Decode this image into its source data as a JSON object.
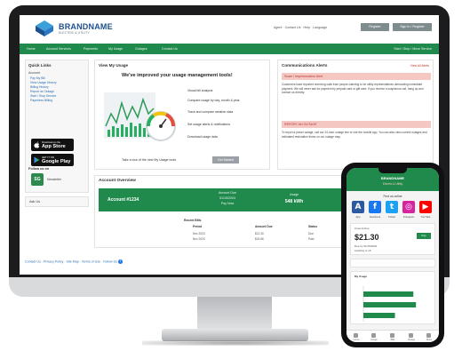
{
  "header": {
    "brand": "BRANDNAME",
    "brand_tagline": "ELECTRIC & UTILITY",
    "top_links": "Agent  ·  Contact Us  ·  Help  ·  Language",
    "register_label": "Register",
    "signin_label": "Sign In / Register"
  },
  "nav": {
    "items": [
      "Home",
      "Account Services",
      "Payments",
      "My Usage",
      "Outages",
      "Contact Us"
    ],
    "right_label": "Start / Stop / Move Service"
  },
  "sidebar": {
    "title": "Quick Links",
    "section": "Account",
    "links": [
      "Pay My Bill",
      "View Usage History",
      "Billing History",
      "Report an Outage",
      "Start / Stop Service",
      "Paperless Billing"
    ],
    "app_store_small": "Download on the",
    "app_store_big": "App Store",
    "google_small": "GET IT ON",
    "google_big": "Google Play",
    "social_title": "Follow us on",
    "social_label": "Newsletter",
    "logo_text": "SG",
    "box2_label": "Ask Us"
  },
  "usage": {
    "title": "View My Usage",
    "headline": "We've improved your usage management tools!",
    "features": [
      "Visual bill analysis",
      "Compare usage by day, month & year",
      "Track and compare weather data",
      "Set usage alerts & notifications",
      "Download usage data"
    ],
    "bottom_text": "Take a tour of the new My Usage tools",
    "start_label": "Get Started"
  },
  "alerts": {
    "title": "Communications Alerts",
    "link": "View All Alerts",
    "banner1": "Scam / Impersonation Alert",
    "text1": "Customers have reported receiving calls from people claiming to be utility representatives demanding immediate payment. We will never ask for payment by prepaid card or gift card. If you receive a suspicious call, hang up and contact us directly.",
    "banner2": "REPORT AN OUTAGE",
    "text2": "To report a power outage, call our 24-hour outage line or use the mobile app. You can also view current outages and estimated restoration times on our outage map."
  },
  "account": {
    "title": "Account Overview",
    "acct_label": "Account #1234",
    "due_label": "Amount Due",
    "due_date": "01/15/2024",
    "due_value": "$21.30",
    "pay_link": "Pay Now",
    "usage_label": "Usage",
    "usage_value": "548 kWh",
    "table_caption": "Recent Bills",
    "table_headers": [
      "Period",
      "Amount Due",
      "Status"
    ],
    "rows": [
      [
        "Dec 2023",
        "$21.30",
        "Due"
      ],
      [
        "Nov 2023",
        "$24.86",
        "Paid"
      ]
    ]
  },
  "footer": {
    "text": "Contact Us  ·  Privacy Policy  ·  Site Map  ·  Terms of Use  ·  Follow Us"
  },
  "phone": {
    "brand": "BRANDNAME",
    "subtitle": "Electric & Utility",
    "find_label": "Find us online",
    "social": [
      {
        "icon": "A",
        "label": "App",
        "color": "#2c5aa0"
      },
      {
        "icon": "f",
        "label": "Facebook",
        "color": "#1877f2"
      },
      {
        "icon": "t",
        "label": "Twitter",
        "color": "#1da1f2"
      },
      {
        "icon": "◎",
        "label": "Instagram",
        "color": "#d6249f"
      },
      {
        "icon": "▶",
        "label": "YouTube",
        "color": "#ff0000"
      }
    ],
    "amount_due_label": "Amount Due",
    "amount": "$21.30",
    "pay_label": "Pay",
    "due_text": "Due by 01/15/2024",
    "autopay_text": "AutoPay is off",
    "chart_title": "My Usage",
    "tabs": [
      "Home",
      "Usage",
      "Bills",
      "Outage",
      "More"
    ]
  },
  "chart_data": {
    "type": "bar",
    "orientation": "horizontal",
    "categories": [
      "",
      "",
      ""
    ],
    "values": [
      38,
      40,
      24
    ],
    "ylim": [
      0,
      50
    ]
  }
}
